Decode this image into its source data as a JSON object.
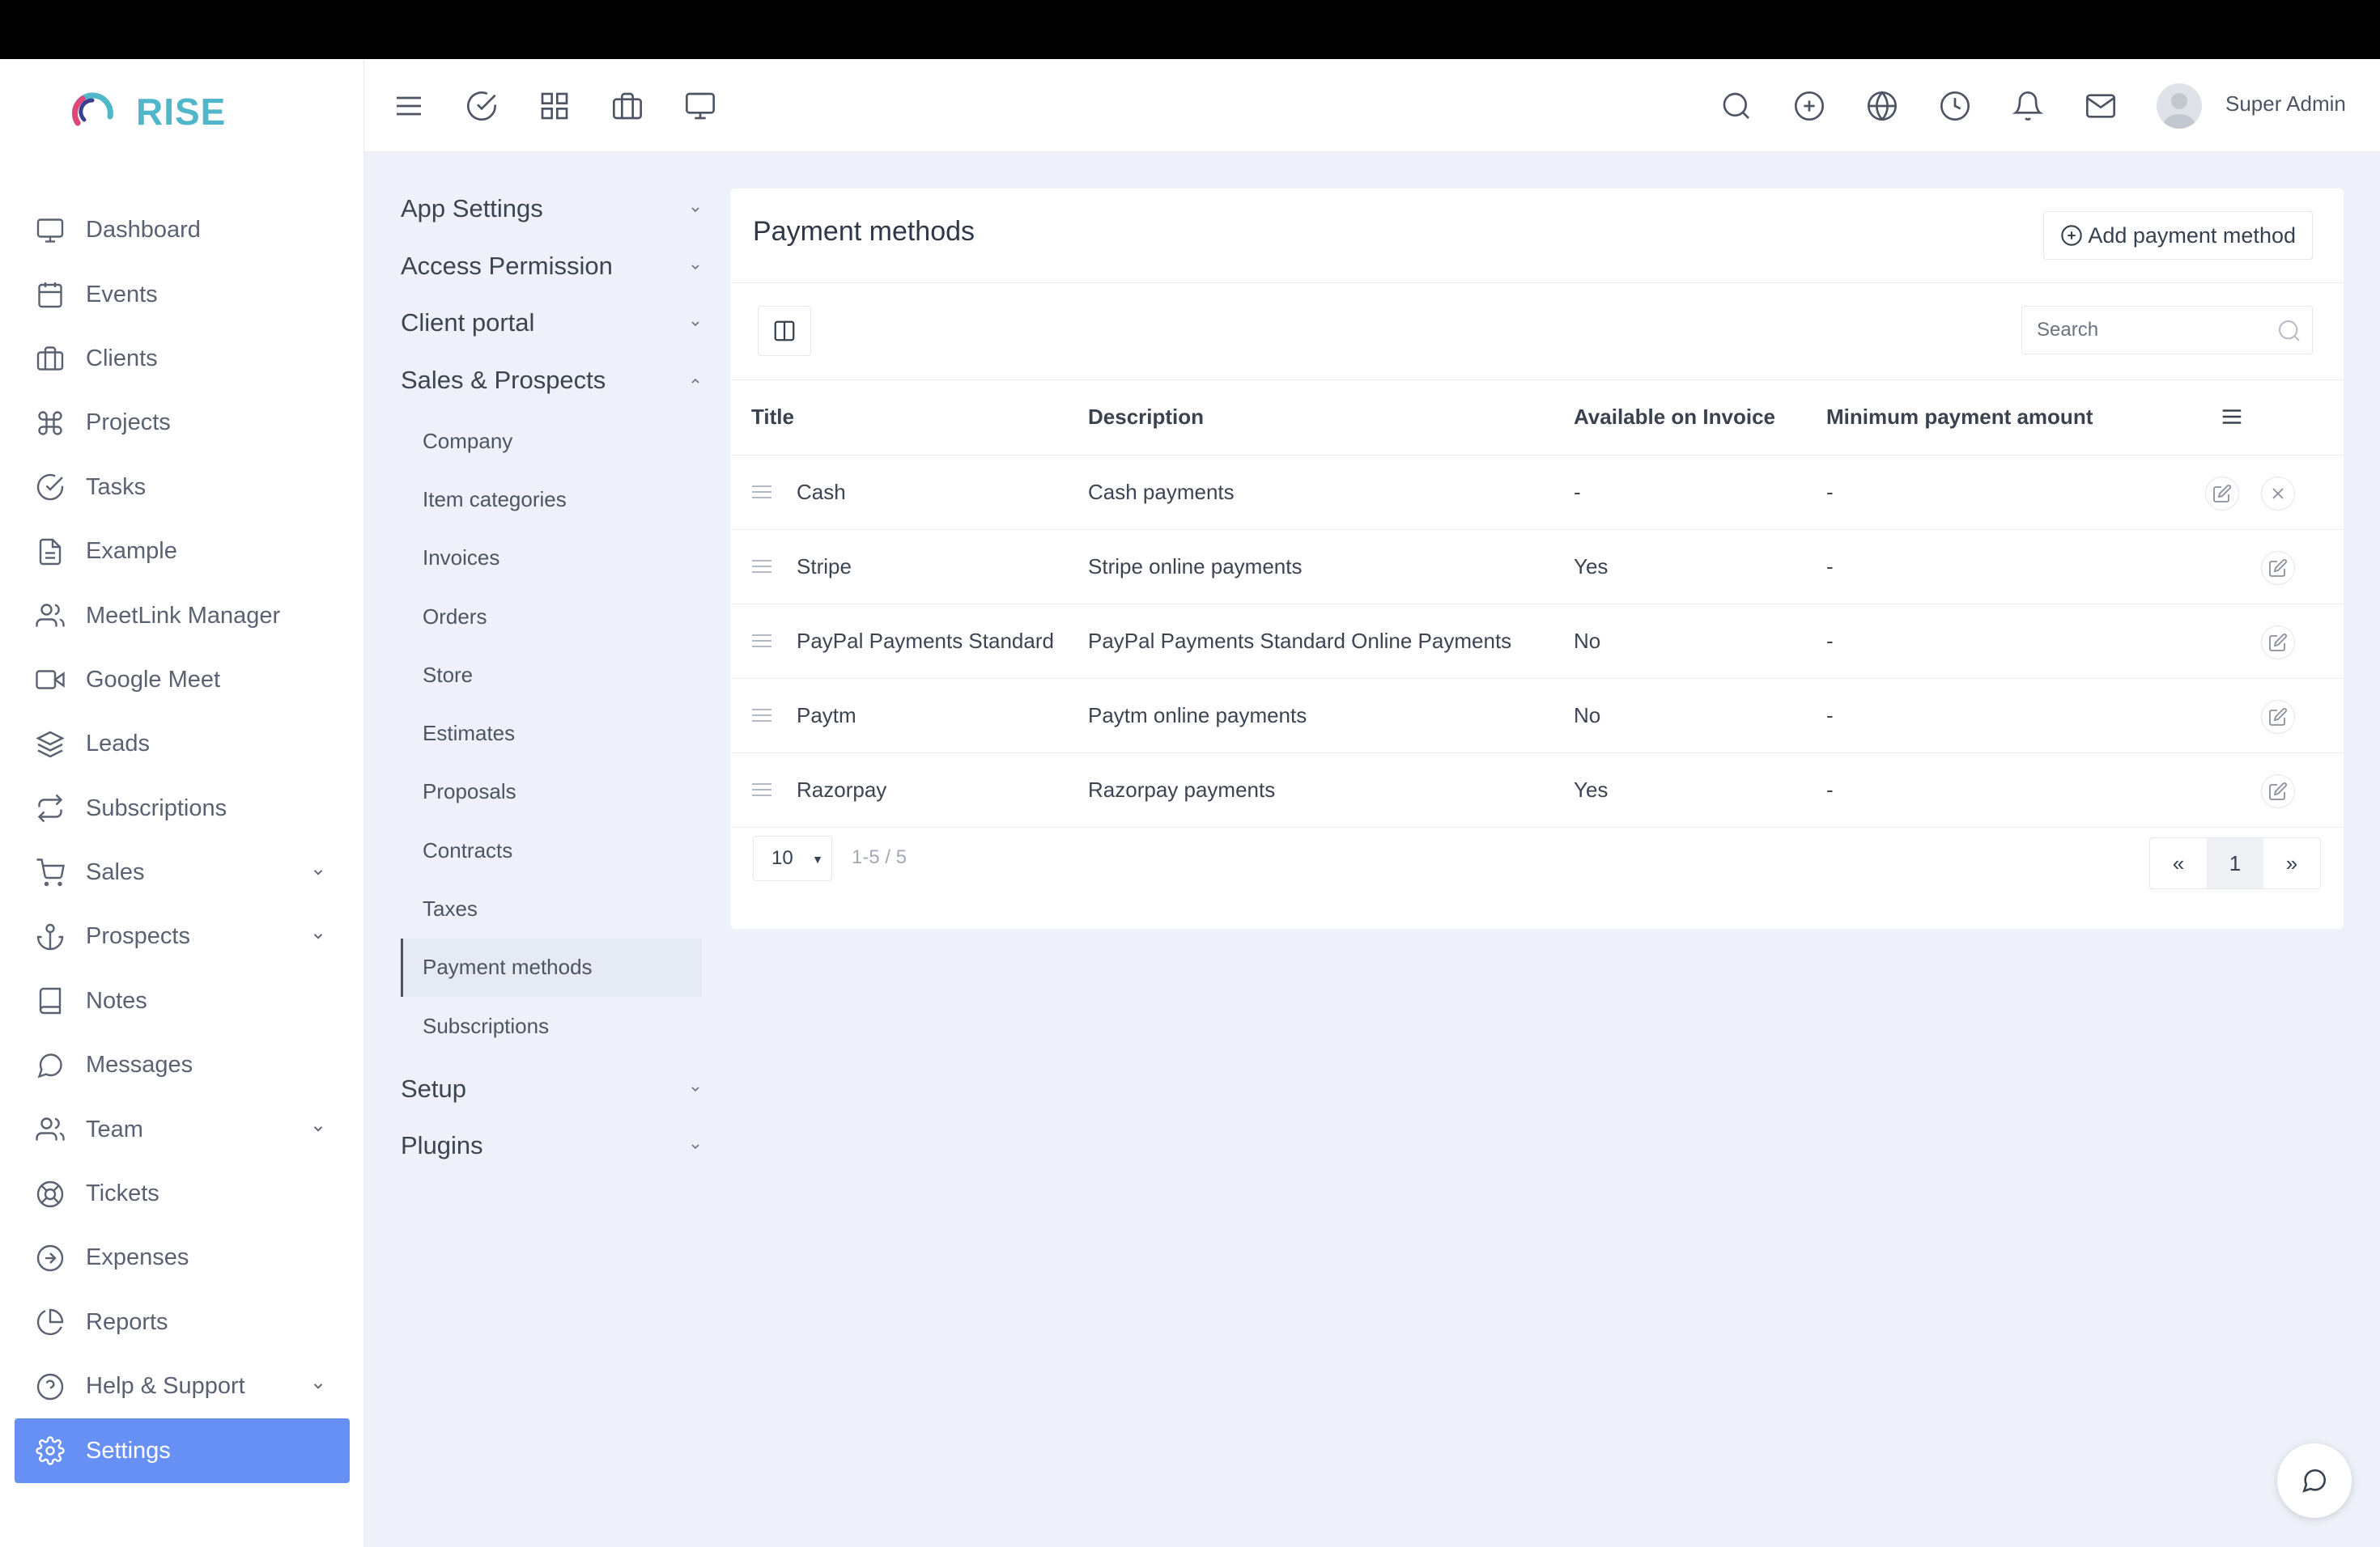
{
  "brand": {
    "name": "RISE"
  },
  "sidebar": {
    "items": [
      {
        "label": "Dashboard",
        "icon": "monitor-icon"
      },
      {
        "label": "Events",
        "icon": "calendar-icon"
      },
      {
        "label": "Clients",
        "icon": "briefcase-icon"
      },
      {
        "label": "Projects",
        "icon": "command-icon"
      },
      {
        "label": "Tasks",
        "icon": "check-circle-icon"
      },
      {
        "label": "Example",
        "icon": "file-text-icon"
      },
      {
        "label": "MeetLink Manager",
        "icon": "users-icon"
      },
      {
        "label": "Google Meet",
        "icon": "video-icon"
      },
      {
        "label": "Leads",
        "icon": "layers-icon"
      },
      {
        "label": "Subscriptions",
        "icon": "repeat-icon"
      },
      {
        "label": "Sales",
        "icon": "shopping-cart-icon"
      },
      {
        "label": "Prospects",
        "icon": "anchor-icon"
      },
      {
        "label": "Notes",
        "icon": "book-icon"
      },
      {
        "label": "Messages",
        "icon": "message-circle-icon"
      },
      {
        "label": "Team",
        "icon": "users-icon"
      },
      {
        "label": "Tickets",
        "icon": "life-buoy-icon"
      },
      {
        "label": "Expenses",
        "icon": "arrow-right-circle-icon"
      },
      {
        "label": "Reports",
        "icon": "pie-chart-icon"
      },
      {
        "label": "Help & Support",
        "icon": "help-circle-icon"
      },
      {
        "label": "Settings",
        "icon": "settings-icon"
      }
    ]
  },
  "header": {
    "user_name": "Super Admin",
    "icons": [
      "menu-icon",
      "check-circle-icon",
      "grid-icon",
      "briefcase-icon",
      "monitor-icon",
      "search-icon",
      "plus-circle-icon",
      "globe-icon",
      "clock-icon",
      "bell-icon",
      "mail-icon"
    ]
  },
  "settings_menu": {
    "groups": {
      "app_settings": "App Settings",
      "access_permission": "Access Permission",
      "client_portal": "Client portal",
      "sales_prospects": "Sales & Prospects",
      "setup": "Setup",
      "plugins": "Plugins"
    },
    "sales_sub_items": [
      "Company",
      "Item categories",
      "Invoices",
      "Orders",
      "Store",
      "Estimates",
      "Proposals",
      "Contracts",
      "Taxes",
      "Payment methods",
      "Subscriptions"
    ],
    "active": "Payment methods"
  },
  "main": {
    "title": "Payment methods",
    "add_button": "Add payment method",
    "search_placeholder": "Search",
    "columns": [
      "Title",
      "Description",
      "Available on Invoice",
      "Minimum payment amount"
    ],
    "rows": [
      {
        "title": "Cash",
        "description": "Cash payments",
        "available": "-",
        "minimum": "-"
      },
      {
        "title": "Stripe",
        "description": "Stripe online payments",
        "available": "Yes",
        "minimum": "-"
      },
      {
        "title": "PayPal Payments Standard",
        "description": "PayPal Payments Standard Online Payments",
        "available": "No",
        "minimum": "-"
      },
      {
        "title": "Paytm",
        "description": "Paytm online payments",
        "available": "No",
        "minimum": "-"
      },
      {
        "title": "Razorpay",
        "description": "Razorpay payments",
        "available": "Yes",
        "minimum": "-"
      }
    ],
    "page_size": "10",
    "range": "1-5 / 5",
    "pager": {
      "first": "«",
      "current": "1",
      "last": "»"
    }
  },
  "colors": {
    "accent": "#6690f4",
    "brand": "#4fb7c9",
    "background": "#eef1f9"
  }
}
